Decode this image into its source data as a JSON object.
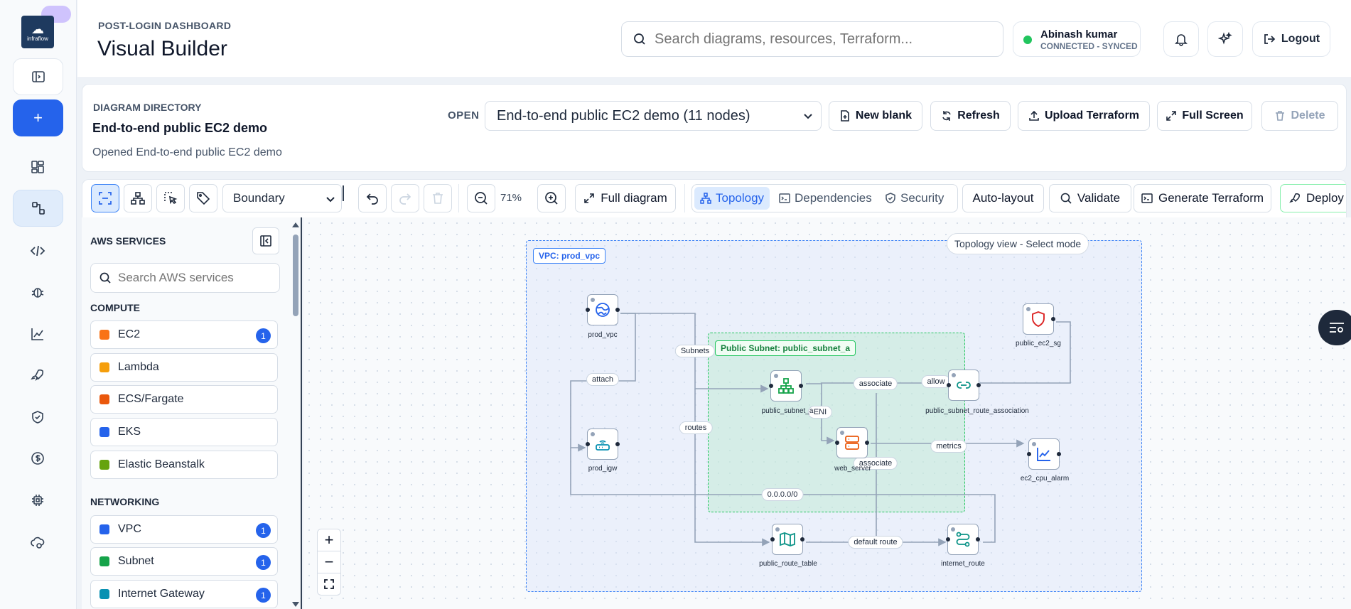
{
  "rail": {
    "logo_text": "infraflow",
    "items": [
      "collapse-sidebar",
      "new-diagram",
      "dashboard",
      "visual-builder",
      "code",
      "bug",
      "analytics",
      "deploy",
      "security",
      "cost",
      "settings",
      "cloud-sync"
    ]
  },
  "header": {
    "eyebrow": "POST-LOGIN DASHBOARD",
    "title": "Visual Builder",
    "search_placeholder": "Search diagrams, resources, Terraform...",
    "user_name": "Abinash kumar",
    "user_status": "CONNECTED - SYNCED",
    "logout_label": "Logout"
  },
  "directory": {
    "label": "DIAGRAM DIRECTORY",
    "name": "End-to-end public EC2 demo",
    "status": "Opened End-to-end public EC2 demo",
    "open_label": "OPEN",
    "selected_diagram": "End-to-end public EC2 demo (11 nodes)",
    "actions": {
      "new_blank": "New blank",
      "refresh": "Refresh",
      "upload": "Upload Terraform",
      "fullscreen": "Full Screen",
      "delete": "Delete"
    }
  },
  "toolbar": {
    "mode_select": "Boundary",
    "zoom": "71%",
    "full_diagram": "Full diagram",
    "views": {
      "topology": "Topology",
      "dependencies": "Dependencies",
      "security": "Security"
    },
    "auto_layout": "Auto-layout",
    "validate": "Validate",
    "generate": "Generate Terraform",
    "deploy": "Deploy"
  },
  "sidebar": {
    "title": "AWS SERVICES",
    "search_placeholder": "Search AWS services",
    "sections": [
      {
        "title": "COMPUTE",
        "items": [
          {
            "label": "EC2",
            "color": "#f97316",
            "count": "1"
          },
          {
            "label": "Lambda",
            "color": "#f59e0b",
            "count": ""
          },
          {
            "label": "ECS/Fargate",
            "color": "#ea580c",
            "count": ""
          },
          {
            "label": "EKS",
            "color": "#2563eb",
            "count": ""
          },
          {
            "label": "Elastic Beanstalk",
            "color": "#65a30d",
            "count": ""
          }
        ]
      },
      {
        "title": "NETWORKING",
        "items": [
          {
            "label": "VPC",
            "color": "#2563eb",
            "count": "1"
          },
          {
            "label": "Subnet",
            "color": "#16a34a",
            "count": "1"
          },
          {
            "label": "Internet Gateway",
            "color": "#0891b2",
            "count": "1"
          }
        ]
      }
    ]
  },
  "canvas": {
    "mode_tag": "Topology view - Select mode",
    "vpc_tag": "VPC: prod_vpc",
    "subnet_tag": "Public Subnet: public_subnet_a",
    "nodes": {
      "prod_vpc": "prod_vpc",
      "prod_igw": "prod_igw",
      "public_subnet": "public_subnet_a",
      "web_server": "web_server",
      "route_assoc": "public_subnet_route_association",
      "public_ec2_sg": "public_ec2_sg",
      "ec2_cpu_alarm": "ec2_cpu_alarm",
      "public_route_table": "public_route_table",
      "internet_route": "internet_route"
    },
    "edges": {
      "subnets": "Subnets",
      "attach": "attach",
      "routes": "routes",
      "associate1": "associate",
      "allow": "allow",
      "eni": "ENI",
      "metrics": "metrics",
      "associate2": "associate",
      "cidr": "0.0.0.0/0",
      "default_route": "default route"
    }
  },
  "colors": {
    "accent": "#2563eb",
    "vpc_border": "#3b82f6",
    "subnet_border": "#22c55e",
    "online": "#22c55e"
  }
}
